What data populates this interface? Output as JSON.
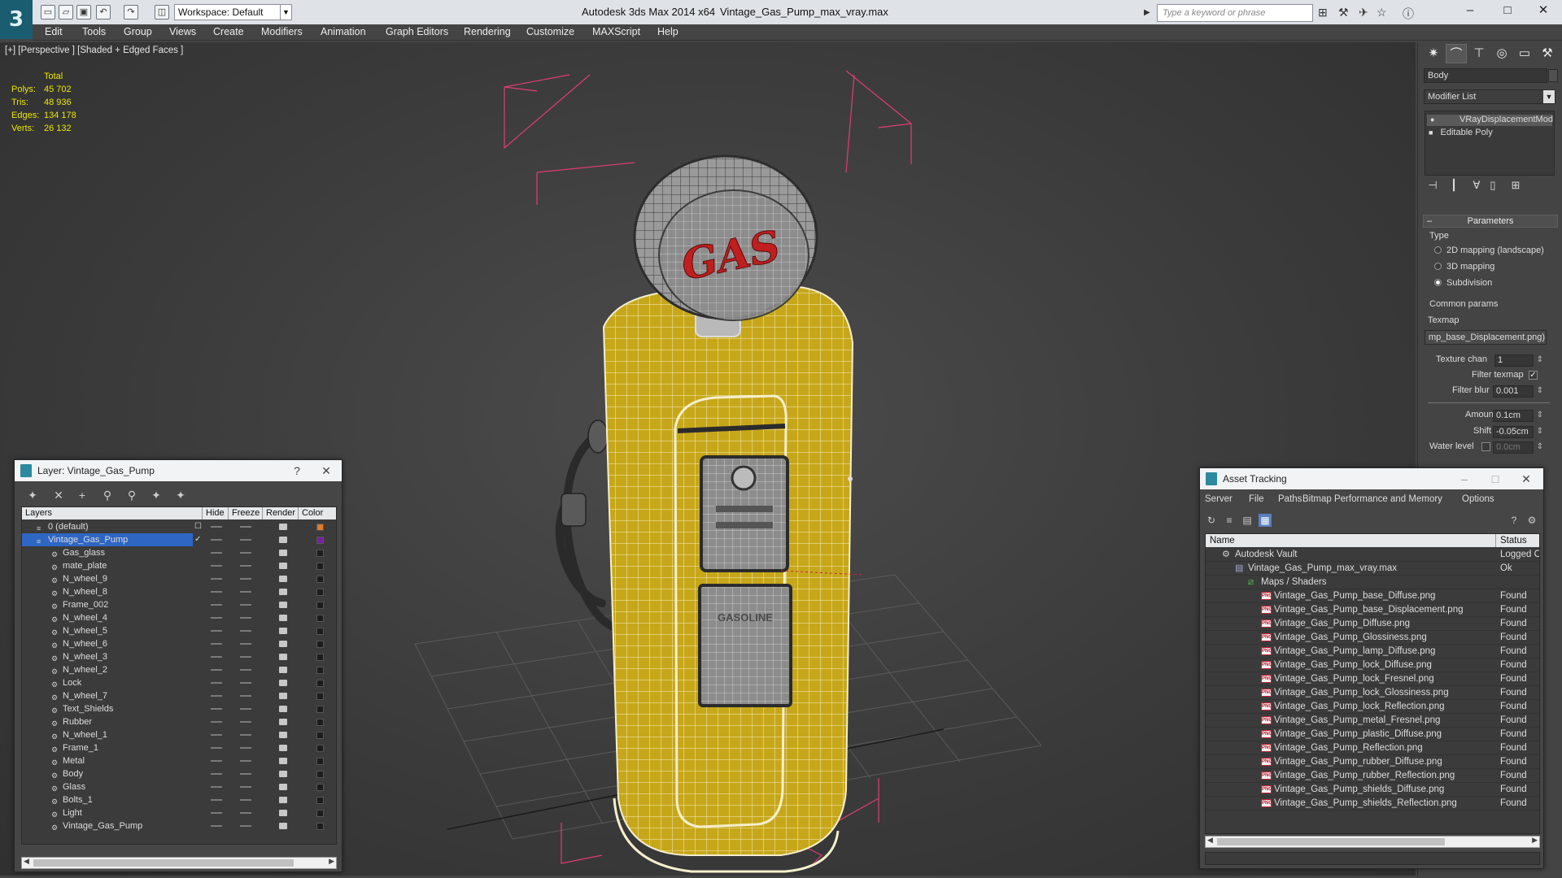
{
  "titlebar": {
    "app_title": "Autodesk 3ds Max 2014 x64",
    "file_title": "Vintage_Gas_Pump_max_vray.max",
    "workspace": "Workspace: Default",
    "search_placeholder": "Type a keyword or phrase"
  },
  "menu": [
    "Edit",
    "Tools",
    "Group",
    "Views",
    "Create",
    "Modifiers",
    "Animation",
    "Graph Editors",
    "Rendering",
    "Customize",
    "MAXScript",
    "Help"
  ],
  "viewport": {
    "label": "[+] [Perspective ] [Shaded + Edged Faces ]",
    "stats": {
      "header": "Total",
      "rows": [
        {
          "label": "Polys:",
          "value": "45 702"
        },
        {
          "label": "Tris:",
          "value": "48 936"
        },
        {
          "label": "Edges:",
          "value": "134 178"
        },
        {
          "label": "Verts:",
          "value": "26 132"
        }
      ]
    },
    "model_text": "GAS",
    "window_text": "GASOLINE"
  },
  "command_panel": {
    "object_name": "Body",
    "modifier_list": "Modifier List",
    "stack": [
      "VRayDisplacementMod",
      "Editable Poly"
    ],
    "parameters": {
      "title": "Parameters",
      "type_label": "Type",
      "types": [
        {
          "label": "2D mapping (landscape)",
          "selected": false
        },
        {
          "label": "3D mapping",
          "selected": false
        },
        {
          "label": "Subdivision",
          "selected": true
        }
      ],
      "common_params": "Common params",
      "texmap_label": "Texmap",
      "texmap_value": "mp_base_Displacement.png)",
      "texture_chan_label": "Texture chan",
      "texture_chan_value": "1",
      "filter_texmap_label": "Filter texmap",
      "filter_blur_label": "Filter blur",
      "filter_blur_value": "0.001",
      "amount_label": "Amount",
      "amount_value": "0.1cm",
      "shift_label": "Shift",
      "shift_value": "-0.05cm",
      "water_level_label": "Water level",
      "water_level_value": "0.0cm"
    }
  },
  "layer_window": {
    "title": "Layer: Vintage_Gas_Pump",
    "help": "?",
    "columns": [
      "Layers",
      "Hide",
      "Freeze",
      "Render",
      "Color"
    ],
    "layers": [
      {
        "name": "0 (default)",
        "level": 0,
        "color": "#e07b2a"
      },
      {
        "name": "Vintage_Gas_Pump",
        "level": 0,
        "color": "#7a1fa0",
        "selected": true
      },
      {
        "name": "Gas_glass",
        "level": 1
      },
      {
        "name": "mate_plate",
        "level": 1
      },
      {
        "name": "N_wheel_9",
        "level": 1
      },
      {
        "name": "N_wheel_8",
        "level": 1
      },
      {
        "name": "Frame_002",
        "level": 1
      },
      {
        "name": "N_wheel_4",
        "level": 1
      },
      {
        "name": "N_wheel_5",
        "level": 1
      },
      {
        "name": "N_wheel_6",
        "level": 1
      },
      {
        "name": "N_wheel_3",
        "level": 1
      },
      {
        "name": "N_wheel_2",
        "level": 1
      },
      {
        "name": "Lock",
        "level": 1
      },
      {
        "name": "N_wheel_7",
        "level": 1
      },
      {
        "name": "Text_Shields",
        "level": 1
      },
      {
        "name": "Rubber",
        "level": 1
      },
      {
        "name": "N_wheel_1",
        "level": 1
      },
      {
        "name": "Frame_1",
        "level": 1
      },
      {
        "name": "Metal",
        "level": 1
      },
      {
        "name": "Body",
        "level": 1
      },
      {
        "name": "Glass",
        "level": 1
      },
      {
        "name": "Bolts_1",
        "level": 1
      },
      {
        "name": "Light",
        "level": 1
      },
      {
        "name": "Vintage_Gas_Pump",
        "level": 1
      }
    ]
  },
  "asset_window": {
    "title": "Asset Tracking",
    "menu": [
      "Server",
      "File",
      "Paths",
      "Bitmap Performance and Memory",
      "Options"
    ],
    "columns": [
      "Name",
      "Status"
    ],
    "rows": [
      {
        "name": "Autodesk Vault",
        "status": "Logged Ou",
        "level": 0,
        "kind": "vault"
      },
      {
        "name": "Vintage_Gas_Pump_max_vray.max",
        "status": "Ok",
        "level": 1,
        "kind": "max"
      },
      {
        "name": "Maps / Shaders",
        "status": "",
        "level": 2,
        "kind": "folder"
      },
      {
        "name": "Vintage_Gas_Pump_base_Diffuse.png",
        "status": "Found",
        "level": 3,
        "kind": "png"
      },
      {
        "name": "Vintage_Gas_Pump_base_Displacement.png",
        "status": "Found",
        "level": 3,
        "kind": "png"
      },
      {
        "name": "Vintage_Gas_Pump_Diffuse.png",
        "status": "Found",
        "level": 3,
        "kind": "png"
      },
      {
        "name": "Vintage_Gas_Pump_Glossiness.png",
        "status": "Found",
        "level": 3,
        "kind": "png"
      },
      {
        "name": "Vintage_Gas_Pump_lamp_Diffuse.png",
        "status": "Found",
        "level": 3,
        "kind": "png"
      },
      {
        "name": "Vintage_Gas_Pump_lock_Diffuse.png",
        "status": "Found",
        "level": 3,
        "kind": "png"
      },
      {
        "name": "Vintage_Gas_Pump_lock_Fresnel.png",
        "status": "Found",
        "level": 3,
        "kind": "png"
      },
      {
        "name": "Vintage_Gas_Pump_lock_Glossiness.png",
        "status": "Found",
        "level": 3,
        "kind": "png"
      },
      {
        "name": "Vintage_Gas_Pump_lock_Reflection.png",
        "status": "Found",
        "level": 3,
        "kind": "png"
      },
      {
        "name": "Vintage_Gas_Pump_metal_Fresnel.png",
        "status": "Found",
        "level": 3,
        "kind": "png"
      },
      {
        "name": "Vintage_Gas_Pump_plastic_Diffuse.png",
        "status": "Found",
        "level": 3,
        "kind": "png"
      },
      {
        "name": "Vintage_Gas_Pump_Reflection.png",
        "status": "Found",
        "level": 3,
        "kind": "png"
      },
      {
        "name": "Vintage_Gas_Pump_rubber_Diffuse.png",
        "status": "Found",
        "level": 3,
        "kind": "png"
      },
      {
        "name": "Vintage_Gas_Pump_rubber_Reflection.png",
        "status": "Found",
        "level": 3,
        "kind": "png"
      },
      {
        "name": "Vintage_Gas_Pump_shields_Diffuse.png",
        "status": "Found",
        "level": 3,
        "kind": "png"
      },
      {
        "name": "Vintage_Gas_Pump_shields_Reflection.png",
        "status": "Found",
        "level": 3,
        "kind": "png"
      }
    ]
  }
}
